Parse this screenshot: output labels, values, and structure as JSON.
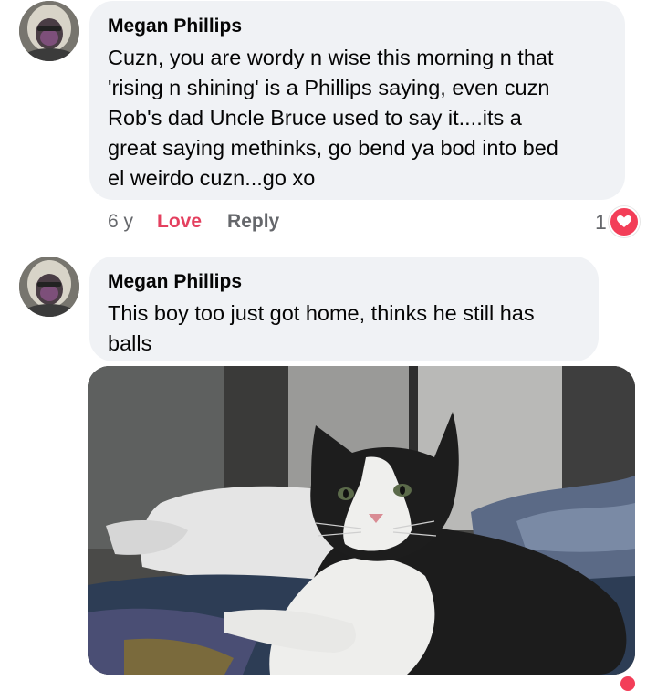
{
  "comments": [
    {
      "author": "Megan Phillips",
      "lines": [
        "Cuzn, you are wordy n wise this  morning n that",
        "'rising n shining' is a Phillips saying, even cuzn",
        "Rob's dad Uncle Bruce used to say it....its a",
        "great saying methinks, go bend ya bod into bed",
        "el weirdo cuzn...go xo"
      ],
      "time": "6 y",
      "love_label": "Love",
      "reply_label": "Reply",
      "reaction_count": "1",
      "reaction_icon": "heart-icon"
    },
    {
      "author": "Megan Phillips",
      "lines": [
        "This boy too just got home, thinks he still has",
        "balls"
      ],
      "attachment": "cat-photo"
    }
  ],
  "colors": {
    "bubble": "#f0f2f5",
    "love": "#e4405f",
    "heart": "#f33e58",
    "meta": "#65676b"
  }
}
